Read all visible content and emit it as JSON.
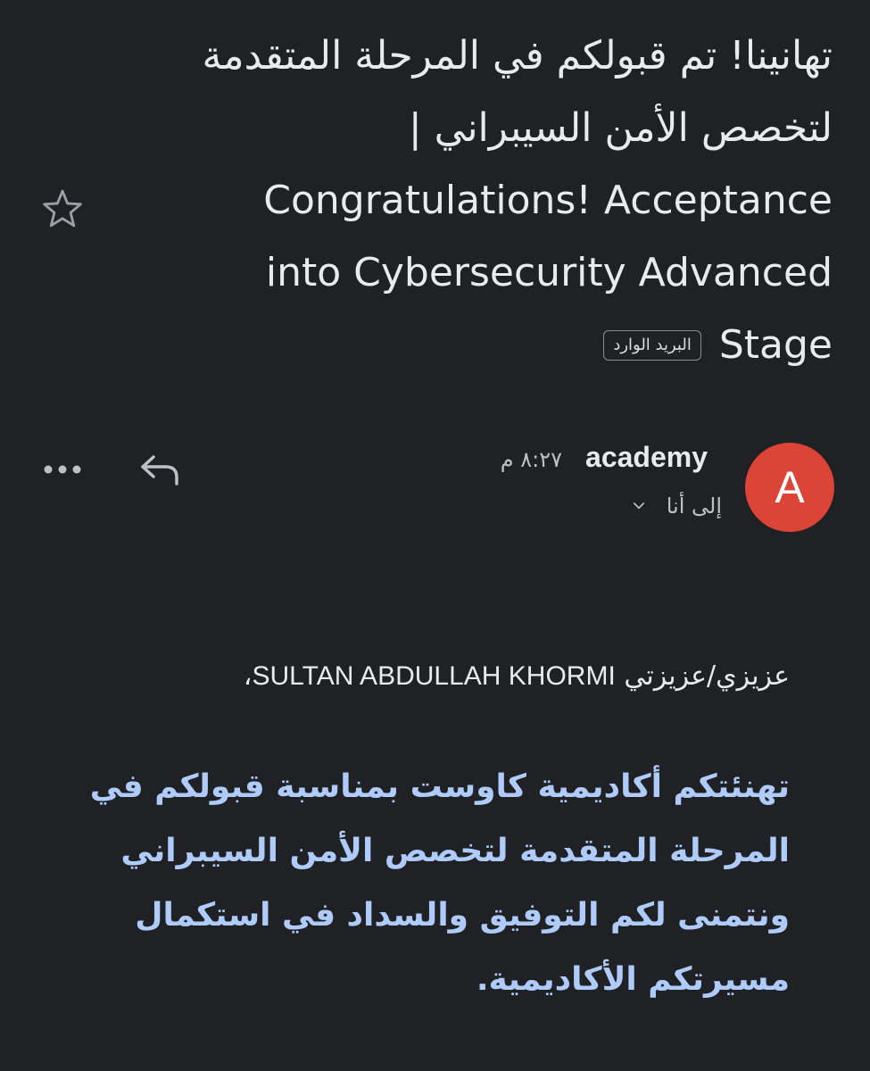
{
  "subject": {
    "lines": [
      "تهانينا! تم قبولكم في المرحلة المتقدمة",
      "لتخصص الأمن السيبراني |",
      "Congratulations! Acceptance",
      "into Cybersecurity  Advanced",
      "Stage"
    ],
    "label_chip": "البريد الوارد"
  },
  "icons": {
    "star": "star-outline-icon",
    "reply": "reply-icon",
    "more": "more-horizontal-icon",
    "chevron": "chevron-down-icon"
  },
  "sender": {
    "avatar_letter": "A",
    "avatar_color": "#db4437",
    "name": "academy",
    "time": "٨:٢٧ م",
    "recipient": "إلى أنا"
  },
  "message": {
    "greeting_prefix": "عزيزي/عزيزتي",
    "greeting_name": "SULTAN ABDULLAH KHORMI",
    "greeting_suffix": "،",
    "body_lines": [
      "تهنئتكم أكاديمية كاوست بمناسبة قبولكم في",
      "المرحلة المتقدمة لتخصص الأمن السيبراني",
      "ونتمنى لكم التوفيق والسداد في استكمال",
      "مسيرتكم الأكاديمية."
    ],
    "body_color": "#aecbfa"
  },
  "colors": {
    "background": "#202124",
    "text_primary": "#e8eaed",
    "text_secondary": "#bdc1c6"
  }
}
